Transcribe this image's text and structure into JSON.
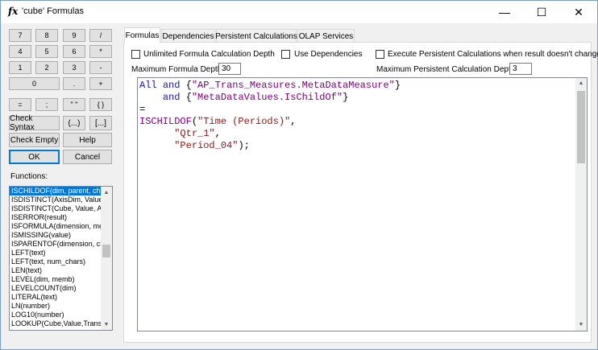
{
  "window": {
    "title": "'cube' Formulas",
    "title_icon": "fx",
    "minimize_glyph": "—",
    "maximize_glyph": "☐",
    "close_glyph": "✕"
  },
  "calculator": {
    "rows": [
      [
        "7",
        "8",
        "9",
        "/"
      ],
      [
        "4",
        "5",
        "6",
        "*"
      ],
      [
        "1",
        "2",
        "3",
        "-"
      ]
    ],
    "zero": "0",
    "dot": ".",
    "plus": "+",
    "equals": "=",
    "semicolon": ";",
    "quotes": "\" \"",
    "braces": "{ }",
    "check_syntax": "Check Syntax",
    "paren_dots": "(...)",
    "bracket_dots": "[...]",
    "check_empty": "Check Empty",
    "help": "Help",
    "ok": "OK",
    "cancel": "Cancel"
  },
  "functions": {
    "label": "Functions:",
    "items": [
      "ISCHILDOF(dim, parent, child)",
      "ISDISTINCT(AxisDim, Value)",
      "ISDISTINCT(Cube, Value, Axis)",
      "ISERROR(result)",
      "ISFORMULA(dimension, member)",
      "ISMISSING(value)",
      "ISPARENTOF(dimension, child)",
      "LEFT(text)",
      "LEFT(text, num_chars)",
      "LEN(text)",
      "LEVEL(dim, memb)",
      "LEVELCOUNT(dim)",
      "LITERAL(text)",
      "LN(number)",
      "LOG10(number)",
      "LOOKUP(Cube,Value,Transl)"
    ],
    "selected_index": 0
  },
  "tabs": [
    {
      "label": "Formulas",
      "active": true
    },
    {
      "label": "Dependencies",
      "active": false
    },
    {
      "label": "Persistent Calculations",
      "active": false
    },
    {
      "label": "OLAP Services",
      "active": false
    }
  ],
  "options": {
    "unlimited_depth": {
      "label": "Unlimited Formula Calculation Depth",
      "checked": false
    },
    "use_dependencies": {
      "label": "Use Dependencies",
      "checked": false
    },
    "execute_persistent": {
      "label": "Execute Persistent Calculations when result doesn't change",
      "checked": false
    },
    "max_formula_depth": {
      "label": "Maximum Formula Depth:",
      "value": "30"
    },
    "max_persistent_depth": {
      "label": "Maximum Persistent Calculation Depth:",
      "value": "3"
    }
  },
  "editor": {
    "lines": [
      [
        {
          "t": "All",
          "c": "kw-blue"
        },
        {
          "t": " ",
          "c": "plain"
        },
        {
          "t": "and",
          "c": "kw-blue"
        },
        {
          "t": " {",
          "c": "plain"
        },
        {
          "t": "\"AP_Trans_Measures.MetaDataMeasure\"",
          "c": "kw-purple"
        },
        {
          "t": "}",
          "c": "plain"
        }
      ],
      [
        {
          "t": "    ",
          "c": "plain"
        },
        {
          "t": "and",
          "c": "kw-blue"
        },
        {
          "t": " {",
          "c": "plain"
        },
        {
          "t": "\"MetaDataValues.IsChildOf\"",
          "c": "kw-purple"
        },
        {
          "t": "}",
          "c": "plain"
        }
      ],
      [
        {
          "t": "=",
          "c": "plain"
        }
      ],
      [
        {
          "t": "ISCHILDOF",
          "c": "kw-purple"
        },
        {
          "t": "(",
          "c": "plain"
        },
        {
          "t": "\"Time (Periods)\"",
          "c": "str"
        },
        {
          "t": ",",
          "c": "plain"
        }
      ],
      [
        {
          "t": "      ",
          "c": "plain"
        },
        {
          "t": "\"Qtr_1\"",
          "c": "str"
        },
        {
          "t": ",",
          "c": "plain"
        }
      ],
      [
        {
          "t": "      ",
          "c": "plain"
        },
        {
          "t": "\"Period_04\"",
          "c": "str"
        },
        {
          "t": ");",
          "c": "plain"
        }
      ]
    ]
  },
  "icons": {
    "scroll_up": "▲",
    "scroll_down": "▼"
  }
}
